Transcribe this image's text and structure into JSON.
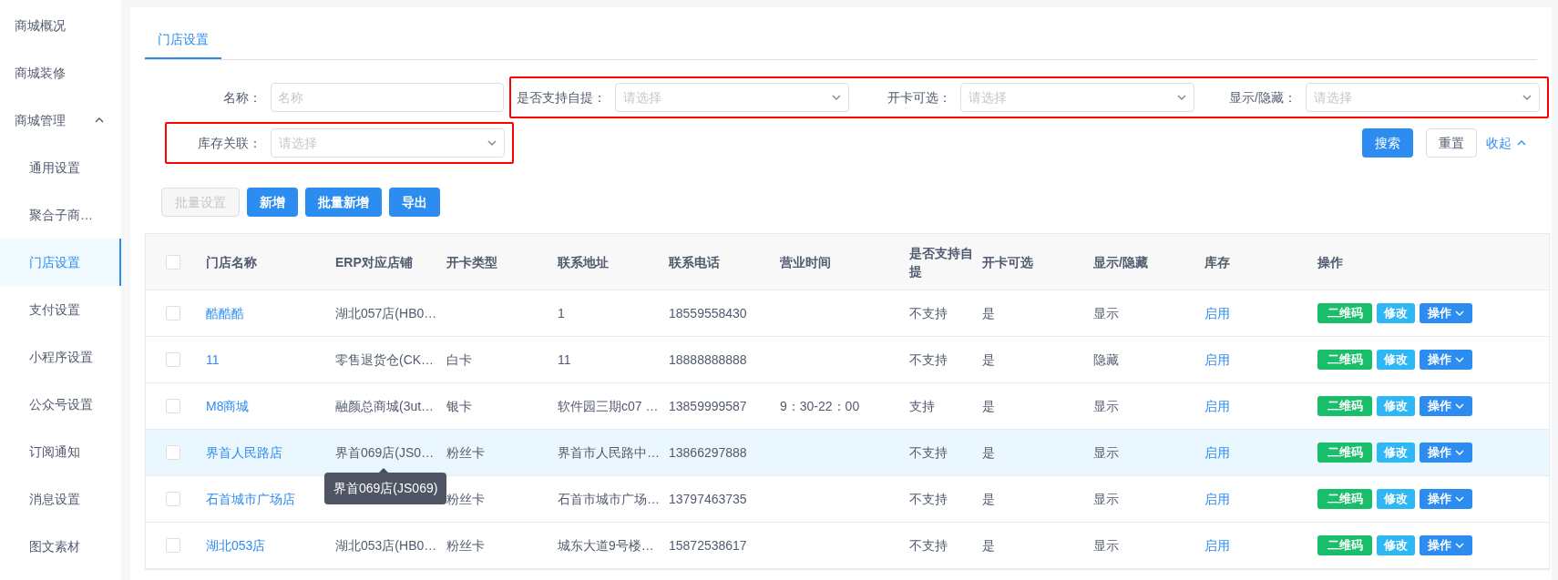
{
  "sidebar": {
    "items": [
      {
        "label": "商城概况",
        "selected": false
      },
      {
        "label": "商城装修",
        "selected": false
      },
      {
        "label": "商城管理",
        "selected": false,
        "expanded": true,
        "children": [
          {
            "label": "通用设置",
            "selected": false
          },
          {
            "label": "聚合子商…",
            "selected": false
          },
          {
            "label": "门店设置",
            "selected": true
          },
          {
            "label": "支付设置",
            "selected": false
          },
          {
            "label": "小程序设置",
            "selected": false
          },
          {
            "label": "公众号设置",
            "selected": false
          },
          {
            "label": "订阅通知",
            "selected": false
          },
          {
            "label": "消息设置",
            "selected": false
          },
          {
            "label": "图文素材",
            "selected": false
          }
        ]
      }
    ]
  },
  "tabs": [
    {
      "label": "门店设置",
      "selected": true
    }
  ],
  "filters": [
    [
      {
        "label": "名称：",
        "kind": "input",
        "placeholder": "名称",
        "highlighted": false
      },
      {
        "label": "是否支持自提：",
        "kind": "select",
        "placeholder": "请选择",
        "highlighted": true
      },
      {
        "label": "开卡可选：",
        "kind": "select",
        "placeholder": "请选择",
        "highlighted": true
      },
      {
        "label": "显示/隐藏：",
        "kind": "select",
        "placeholder": "请选择",
        "highlighted": true
      }
    ],
    [
      {
        "label": "库存关联：",
        "kind": "select",
        "placeholder": "请选择",
        "highlighted": true
      }
    ]
  ],
  "filter_actions": {
    "search": "搜索",
    "reset": "重置",
    "collapse": "收起"
  },
  "toolbar": [
    {
      "label": "批量设置",
      "disabled": true
    },
    {
      "label": "新增",
      "disabled": false
    },
    {
      "label": "批量新增",
      "disabled": false
    },
    {
      "label": "导出",
      "disabled": false
    }
  ],
  "table": {
    "header_checked": false,
    "columns": [
      "门店名称",
      "ERP对应店铺",
      "开卡类型",
      "联系地址",
      "联系电话",
      "营业时间",
      "是否支持自提",
      "开卡可选",
      "显示/隐藏",
      "库存",
      "操作"
    ],
    "rows": [
      {
        "checked": false,
        "highlighted": false,
        "cells": [
          "酷酷酷",
          "湖北057店(HB0…",
          null,
          "1",
          "18559558430",
          null,
          "不支持",
          "是",
          "显示",
          "启用"
        ],
        "actions": [
          {
            "kind": "qr",
            "label": "二维码"
          },
          {
            "kind": "edit",
            "label": "修改"
          },
          {
            "kind": "menu",
            "label": "操作"
          }
        ]
      },
      {
        "checked": false,
        "highlighted": false,
        "cells": [
          "11",
          "零售退货仓(CK…",
          "白卡",
          "11",
          "18888888888",
          null,
          "不支持",
          "是",
          "隐藏",
          "启用"
        ],
        "actions": [
          {
            "kind": "qr",
            "label": "二维码"
          },
          {
            "kind": "edit",
            "label": "修改"
          },
          {
            "kind": "menu",
            "label": "操作"
          }
        ]
      },
      {
        "checked": false,
        "highlighted": false,
        "cells": [
          "M8商城",
          "融颜总商城(3ut…",
          "银卡",
          "软件园三期c07 …",
          "13859999587",
          "9：30-22：00",
          "支持",
          "是",
          "显示",
          "启用"
        ],
        "actions": [
          {
            "kind": "qr",
            "label": "二维码"
          },
          {
            "kind": "edit",
            "label": "修改"
          },
          {
            "kind": "menu",
            "label": "操作"
          }
        ]
      },
      {
        "checked": false,
        "highlighted": true,
        "tooltip": "界首069店(JS069)",
        "cells": [
          "界首人民路店",
          "界首069店(JS0…",
          "粉丝卡",
          "界首市人民路中…",
          "13866297888",
          null,
          "不支持",
          "是",
          "显示",
          "启用"
        ],
        "actions": [
          {
            "kind": "qr",
            "label": "二维码"
          },
          {
            "kind": "edit",
            "label": "修改"
          },
          {
            "kind": "menu",
            "label": "操作"
          }
        ]
      },
      {
        "checked": false,
        "highlighted": false,
        "cells": [
          "石首城市广场店",
          null,
          "粉丝卡",
          "石首市城市广场…",
          "13797463735",
          null,
          "不支持",
          "是",
          "显示",
          "启用"
        ],
        "actions": [
          {
            "kind": "qr",
            "label": "二维码"
          },
          {
            "kind": "edit",
            "label": "修改"
          },
          {
            "kind": "menu",
            "label": "操作"
          }
        ]
      },
      {
        "checked": false,
        "highlighted": false,
        "cells": [
          "湖北053店",
          "湖北053店(HB0…",
          "粉丝卡",
          "城东大道9号楼…",
          "15872538617",
          null,
          "不支持",
          "是",
          "显示",
          "启用"
        ],
        "actions": [
          {
            "kind": "qr",
            "label": "二维码"
          },
          {
            "kind": "edit",
            "label": "修改"
          },
          {
            "kind": "menu",
            "label": "操作"
          }
        ]
      }
    ]
  }
}
